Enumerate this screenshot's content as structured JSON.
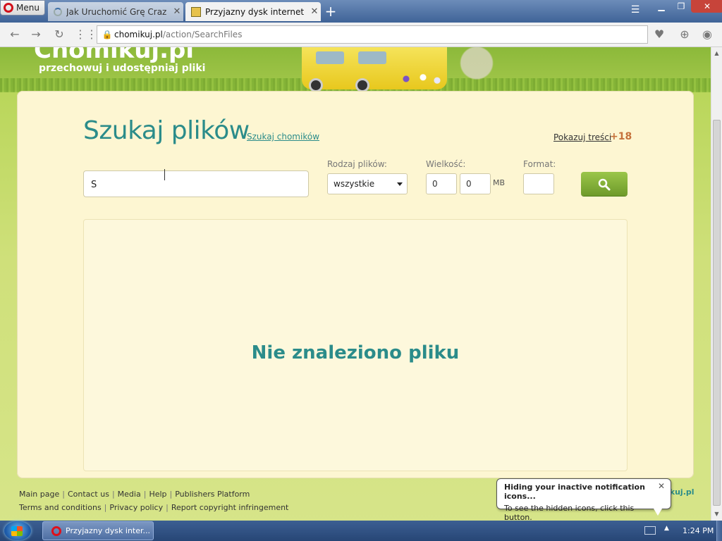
{
  "browser": {
    "menu_label": "Menu",
    "tabs": [
      {
        "title": "Jak Uruchomić Grę Crazy D…",
        "state": "loading"
      },
      {
        "title": "Przyjazny dysk internetowy",
        "state": "active"
      }
    ],
    "new_tab_icon": "plus-icon",
    "url": {
      "host": "chomikuj.pl",
      "path": "/action/SearchFiles"
    }
  },
  "site": {
    "logo_text": "Chomikuj.pl",
    "tagline": "przechowuj i udostępniaj pliki",
    "search": {
      "title": "Szukaj plików",
      "alt_link": "Szukaj chomików",
      "show_content_link": "Pokazuj treści",
      "adult_badge": "+18",
      "query_value": "S",
      "file_type": {
        "label": "Rodzaj plików:",
        "selected": "wszystkie"
      },
      "size": {
        "label": "Wielkość:",
        "min": "0",
        "max": "0",
        "unit": "MB"
      },
      "format": {
        "label": "Format:",
        "value": ""
      },
      "submit_icon": "search-icon"
    },
    "results": {
      "empty_message": "Nie znaleziono pliku"
    },
    "footer": {
      "row1": [
        "Main page",
        "Contact us",
        "Media",
        "Help",
        "Publishers Platform"
      ],
      "row2": [
        "Terms and conditions",
        "Privacy policy",
        "Report copyright infringement"
      ],
      "brand": "ikuj.pl"
    }
  },
  "notification": {
    "title": "Hiding your inactive notification icons...",
    "body": "To see the hidden icons, click this button."
  },
  "taskbar": {
    "window_title": "Przyjazny dysk inter...",
    "clock": "1:24 PM"
  },
  "colors": {
    "accent_teal": "#2b8c8a",
    "button_green": "#7fae36",
    "panel_bg": "#fdf6d2",
    "adult_badge": "#c5713b"
  }
}
